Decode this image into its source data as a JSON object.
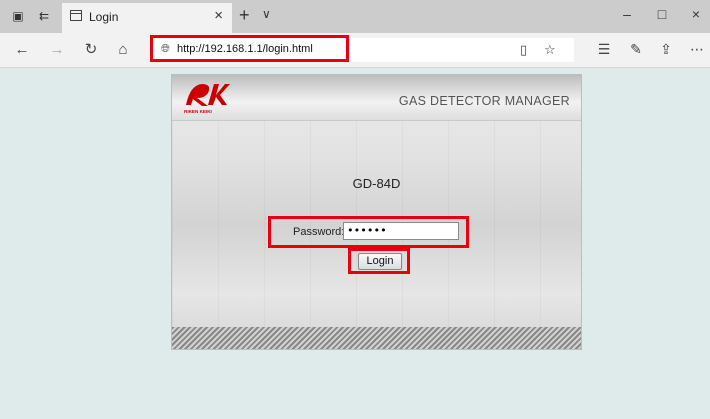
{
  "browser": {
    "tab_title": "Login",
    "address": "http://192.168.1.1/login.html",
    "icons": {
      "tab_actions": "tab-actions-icon",
      "set_aside": "set-aside-tabs-icon",
      "page": "page-icon",
      "close": "close-icon",
      "new_tab": "plus-icon",
      "tab_menu": "chevron-down-icon",
      "back": "back-arrow-icon",
      "forward": "forward-arrow-icon",
      "refresh": "refresh-icon",
      "home": "home-icon",
      "site_info": "globe-icon",
      "reading_view": "book-icon",
      "favorite": "star-icon",
      "favorites_list": "favorites-icon",
      "pen": "pen-icon",
      "share": "share-icon",
      "more": "more-icon"
    }
  },
  "page": {
    "logo_text": "RIKEN KEIKI",
    "header_title": "GAS DETECTOR MANAGER",
    "device_name": "GD-84D",
    "password_label": "Password:",
    "password_value": "••••••",
    "login_button": "Login"
  },
  "colors": {
    "highlight": "#e8000e",
    "logo": "#cc0000",
    "page_background": "#dfeaea"
  }
}
